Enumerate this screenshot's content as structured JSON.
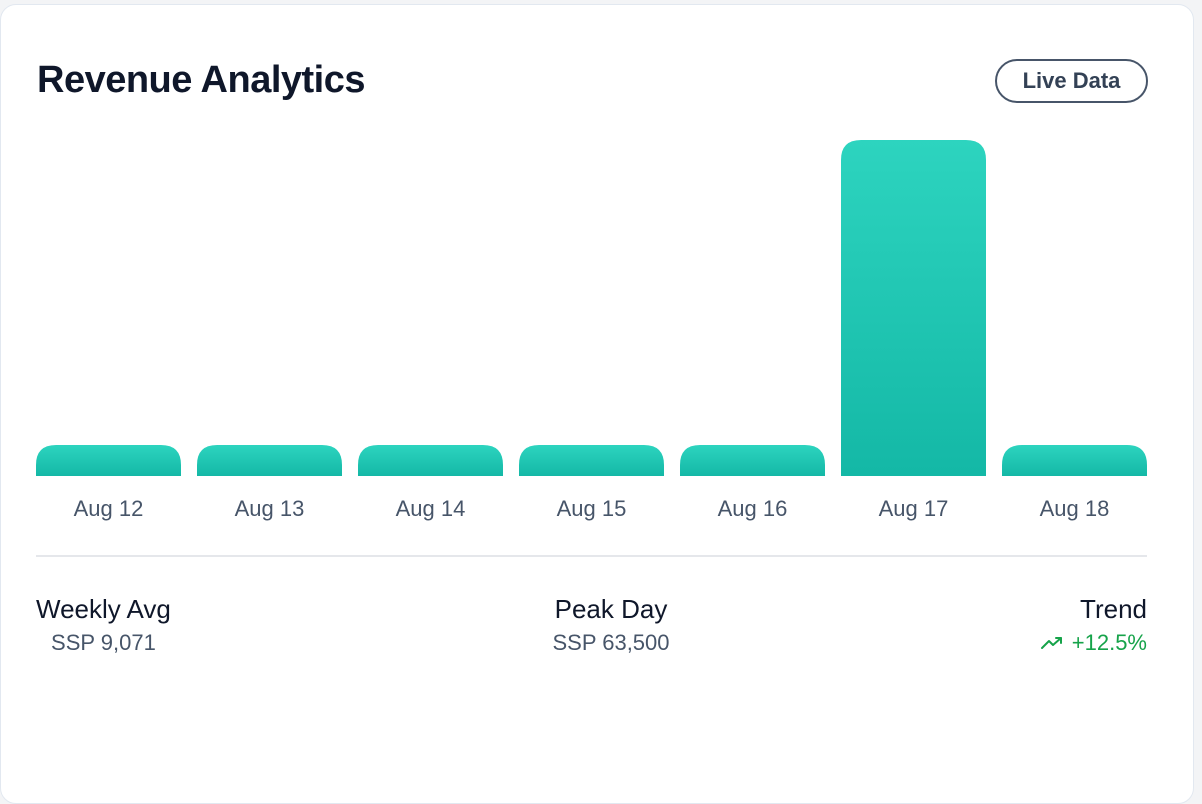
{
  "header": {
    "title": "Revenue Analytics",
    "badge": "Live Data"
  },
  "chart_data": {
    "type": "bar",
    "categories": [
      "Aug 12",
      "Aug 13",
      "Aug 14",
      "Aug 15",
      "Aug 16",
      "Aug 17",
      "Aug 18"
    ],
    "values": [
      0,
      0,
      0,
      0,
      0,
      63500,
      0
    ],
    "ylim": [
      0,
      63500
    ],
    "grid": false,
    "bar_color_top": "#2dd4bf",
    "bar_color_bottom": "#14b8a6"
  },
  "stats": {
    "weekly_avg": {
      "label": "Weekly Avg",
      "value": "SSP 9,071"
    },
    "peak_day": {
      "label": "Peak Day",
      "value": "SSP 63,500"
    },
    "trend": {
      "label": "Trend",
      "value": "+12.5%",
      "icon": "trending-up-icon",
      "color": "#16a34a"
    }
  }
}
